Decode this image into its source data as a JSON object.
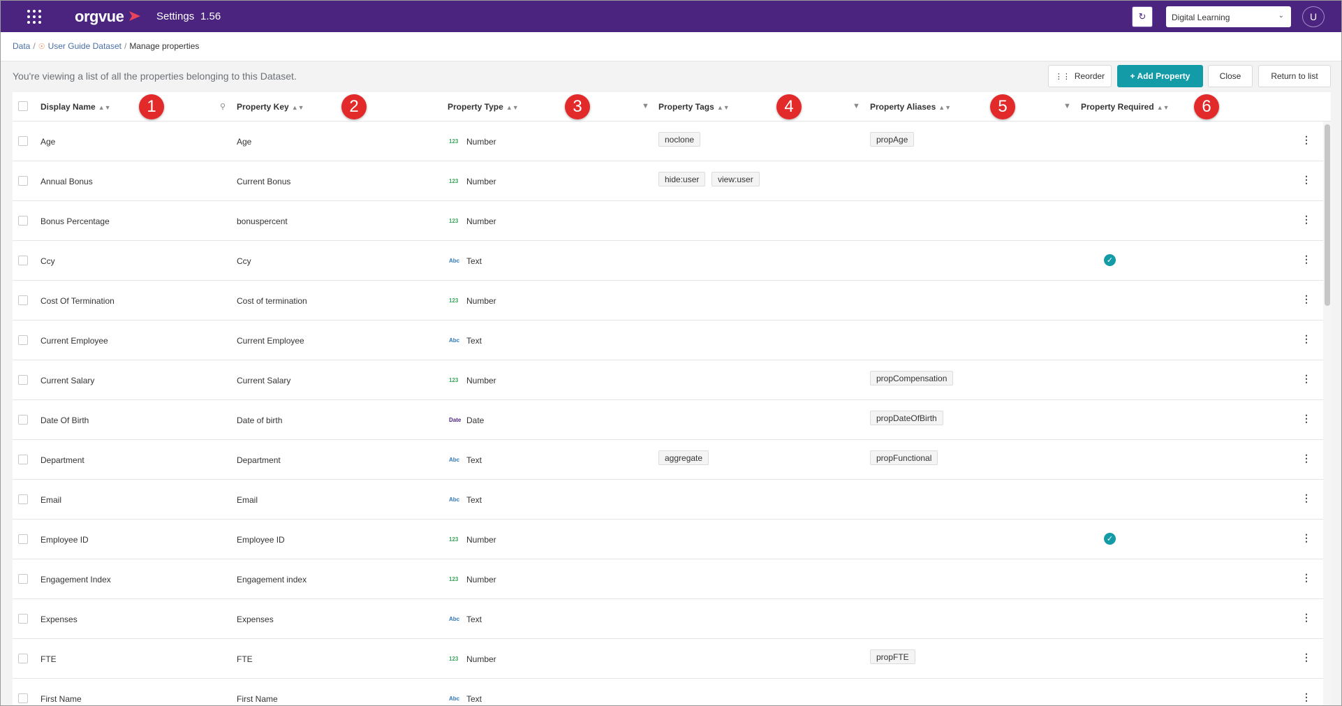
{
  "topbar": {
    "logo": "orgvue",
    "title": "Settings",
    "version": "1.56",
    "workspace": "Digital Learning",
    "user_initial": "U",
    "bg_color": "#4b2480"
  },
  "breadcrumb": {
    "root": "Data",
    "dataset": "User Guide Dataset",
    "current": "Manage properties"
  },
  "info_text": "You're viewing a list of all the properties belonging to this Dataset.",
  "actions": {
    "reorder": "Reorder",
    "add_property": "+ Add Property",
    "close": "Close",
    "return": "Return to list",
    "accent_color": "#139ca8"
  },
  "columns": {
    "display_name": "Display Name",
    "property_key": "Property Key",
    "property_type": "Property Type",
    "property_tags": "Property Tags",
    "property_aliases": "Property Aliases",
    "property_required": "Property Required"
  },
  "callouts": [
    "1",
    "2",
    "3",
    "4",
    "5",
    "6"
  ],
  "type_icons": {
    "number": "123",
    "text": "Abc",
    "date": "Date"
  },
  "rows": [
    {
      "name": "Age",
      "key": "Age",
      "type": "Number",
      "icon": "123",
      "tags": [
        "noclone"
      ],
      "alias": "propAge",
      "required": false
    },
    {
      "name": "Annual Bonus",
      "key": "Current Bonus",
      "type": "Number",
      "icon": "123",
      "tags": [
        "hide:user",
        "view:user"
      ],
      "alias": "",
      "required": false
    },
    {
      "name": "Bonus Percentage",
      "key": "bonuspercent",
      "type": "Number",
      "icon": "123",
      "tags": [],
      "alias": "",
      "required": false
    },
    {
      "name": "Ccy",
      "key": "Ccy",
      "type": "Text",
      "icon": "Abc",
      "tags": [],
      "alias": "",
      "required": true
    },
    {
      "name": "Cost Of Termination",
      "key": "Cost of termination",
      "type": "Number",
      "icon": "123",
      "tags": [],
      "alias": "",
      "required": false
    },
    {
      "name": "Current Employee",
      "key": "Current Employee",
      "type": "Text",
      "icon": "Abc",
      "tags": [],
      "alias": "",
      "required": false
    },
    {
      "name": "Current Salary",
      "key": "Current Salary",
      "type": "Number",
      "icon": "123",
      "tags": [],
      "alias": "propCompensation",
      "required": false
    },
    {
      "name": "Date Of Birth",
      "key": "Date of birth",
      "type": "Date",
      "icon": "Date",
      "tags": [],
      "alias": "propDateOfBirth",
      "required": false
    },
    {
      "name": "Department",
      "key": "Department",
      "type": "Text",
      "icon": "Abc",
      "tags": [
        "aggregate"
      ],
      "alias": "propFunctional",
      "required": false
    },
    {
      "name": "Email",
      "key": "Email",
      "type": "Text",
      "icon": "Abc",
      "tags": [],
      "alias": "",
      "required": false
    },
    {
      "name": "Employee ID",
      "key": "Employee ID",
      "type": "Number",
      "icon": "123",
      "tags": [],
      "alias": "",
      "required": true
    },
    {
      "name": "Engagement Index",
      "key": "Engagement index",
      "type": "Number",
      "icon": "123",
      "tags": [],
      "alias": "",
      "required": false
    },
    {
      "name": "Expenses",
      "key": "Expenses",
      "type": "Text",
      "icon": "Abc",
      "tags": [],
      "alias": "",
      "required": false
    },
    {
      "name": "FTE",
      "key": "FTE",
      "type": "Number",
      "icon": "123",
      "tags": [],
      "alias": "propFTE",
      "required": false
    },
    {
      "name": "First Name",
      "key": "First Name",
      "type": "Text",
      "icon": "Abc",
      "tags": [],
      "alias": "",
      "required": false
    }
  ]
}
